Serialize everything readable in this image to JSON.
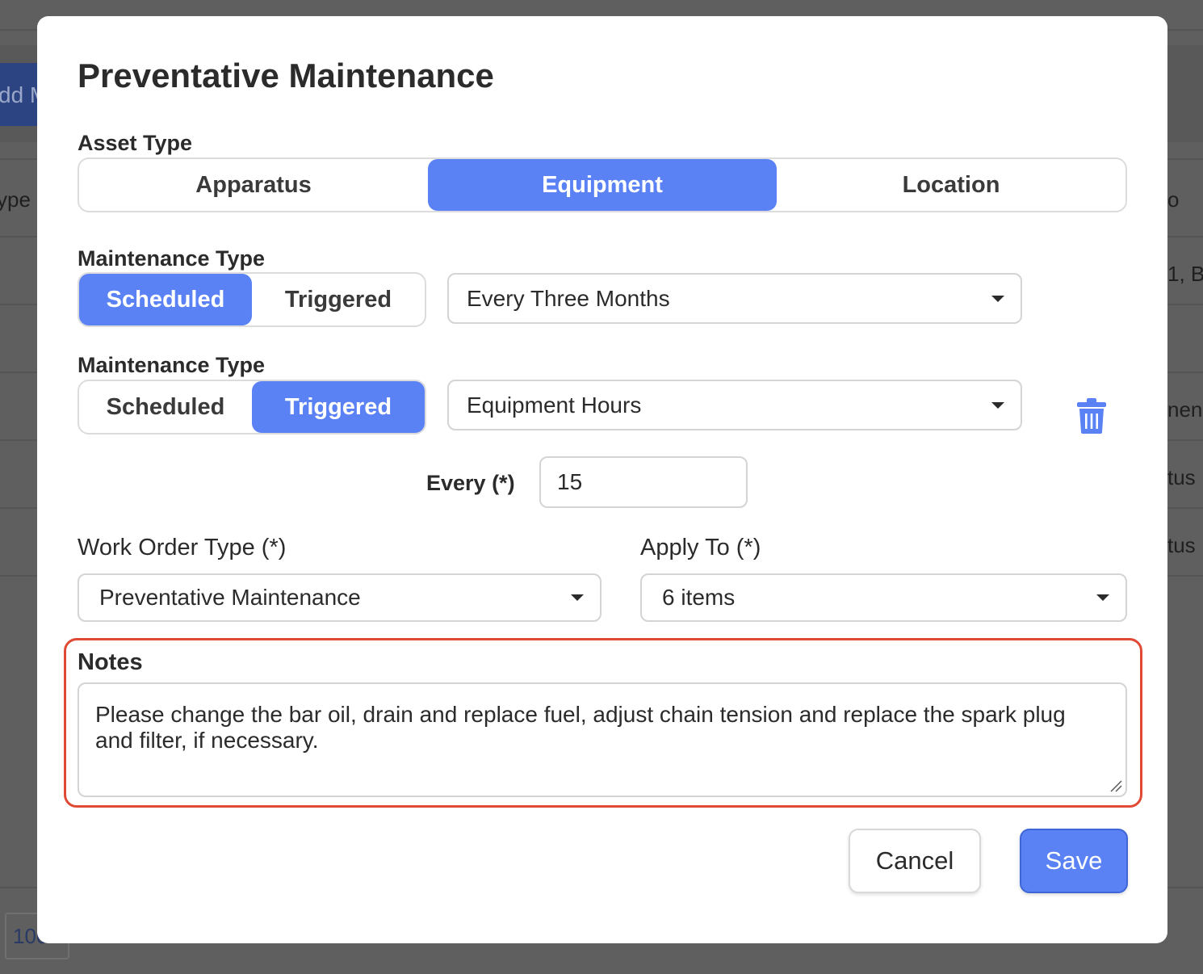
{
  "background": {
    "add_button_label": "dd M",
    "column_fragment_left": "ype",
    "column_fragment_right": "o",
    "cell_1": "1, B",
    "cell_2": "nen",
    "cell_3": "tus",
    "cell_4": "tus",
    "page_size": "100"
  },
  "modal": {
    "title": "Preventative Maintenance",
    "asset_type": {
      "label": "Asset Type",
      "options": [
        "Apparatus",
        "Equipment",
        "Location"
      ],
      "selected": "Equipment"
    },
    "rules": [
      {
        "label": "Maintenance Type",
        "options": [
          "Scheduled",
          "Triggered"
        ],
        "selected": "Scheduled",
        "frequency": "Every Three Months"
      },
      {
        "label": "Maintenance Type",
        "options": [
          "Scheduled",
          "Triggered"
        ],
        "selected": "Triggered",
        "trigger": "Equipment Hours",
        "every_label": "Every (*)",
        "every_value": "15"
      }
    ],
    "work_order_type": {
      "label": "Work Order Type (*)",
      "value": "Preventative Maintenance"
    },
    "apply_to": {
      "label": "Apply To (*)",
      "value": "6 items"
    },
    "notes": {
      "label": "Notes",
      "value": "Please change the bar oil, drain and replace fuel, adjust chain tension and replace the spark plug and filter, if necessary."
    },
    "buttons": {
      "cancel": "Cancel",
      "save": "Save"
    }
  },
  "colors": {
    "accent": "#5a82f5",
    "highlight_border": "#e04a35",
    "overlay": "#5f5f5f"
  },
  "icons": {
    "delete": "trash-icon",
    "dropdown": "caret-down-icon",
    "resize": "resize-grip-icon"
  }
}
